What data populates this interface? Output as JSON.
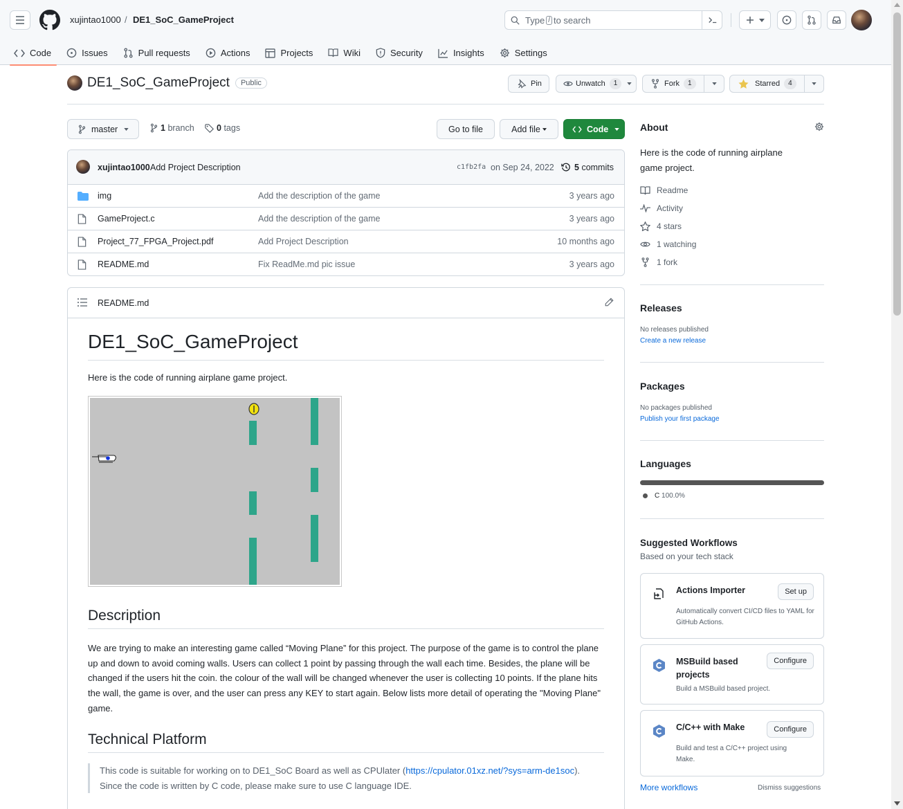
{
  "header": {
    "owner": "xujintao1000",
    "slash": "/",
    "repo": "DE1_SoC_GameProject",
    "search_pre": "Type",
    "search_key": "/",
    "search_post": "to search"
  },
  "tabs": [
    "Code",
    "Issues",
    "Pull requests",
    "Actions",
    "Projects",
    "Wiki",
    "Security",
    "Insights",
    "Settings"
  ],
  "repo": {
    "name": "DE1_SoC_GameProject",
    "visibility": "Public",
    "pin": "Pin",
    "unwatch": "Unwatch",
    "unwatch_count": "1",
    "fork": "Fork",
    "fork_count": "1",
    "starred": "Starred",
    "star_count": "4"
  },
  "branchbar": {
    "branch": "master",
    "branches_n": "1",
    "branches_label": "branch",
    "tags_n": "0",
    "tags_label": "tags",
    "goto": "Go to file",
    "addfile": "Add file",
    "code": "Code"
  },
  "commit": {
    "author": "xujintao1000",
    "message": "Add Project Description",
    "hash": "c1fb2fa",
    "date": "on Sep 24, 2022",
    "commits_n": "5",
    "commits_label": "commits"
  },
  "files": [
    {
      "name": "img",
      "message": "Add the description of the game",
      "age": "3 years ago",
      "type": "dir"
    },
    {
      "name": "GameProject.c",
      "message": "Add the description of the game",
      "age": "3 years ago",
      "type": "file"
    },
    {
      "name": "Project_77_FPGA_Project.pdf",
      "message": "Add Project Description",
      "age": "10 months ago",
      "type": "file"
    },
    {
      "name": "README.md",
      "message": "Fix ReadMe.md pic issue",
      "age": "3 years ago",
      "type": "file"
    }
  ],
  "readme": {
    "filename": "README.md",
    "title": "DE1_SoC_GameProject",
    "intro": "Here is the code of running airplane game project.",
    "h_description": "Description",
    "description": "We are trying to make an interesting game called “Moving Plane” for this project. The purpose of the game is to control the plane up and down to avoid coming walls. Users can collect 1 point by passing through the wall each time. Besides, the plane will be changed if the users hit the coin. the colour of the wall will be changed whenever the user is collecting 10 points. If the plane hits the wall, the game is over, and the user can press any KEY to start again. Below lists more detail of operating the \"Moving Plane\" game.",
    "h_platform": "Technical Platform",
    "platform_pre": "This code is suitable for working on to DE1_SoC Board as well as CPUlater (",
    "platform_link": "https://cpulator.01xz.net/?sys=arm-de1soc",
    "platform_post": "). Since the code is written by C code, please make sure to use C language IDE."
  },
  "about": {
    "title": "About",
    "text": "Here is the code of running airplane game project.",
    "readme": "Readme",
    "activity": "Activity",
    "stars": "4 stars",
    "watching": "1 watching",
    "fork": "1 fork"
  },
  "releases": {
    "title": "Releases",
    "none": "No releases published",
    "link": "Create a new release"
  },
  "packages": {
    "title": "Packages",
    "none": "No packages published",
    "link": "Publish your first package"
  },
  "languages": {
    "title": "Languages",
    "name": "C",
    "pct": "100.0%",
    "color": "#555555"
  },
  "workflows": {
    "title": "Suggested Workflows",
    "subtitle": "Based on your tech stack",
    "items": [
      {
        "name": "Actions Importer",
        "desc": "Automatically convert CI/CD files to YAML for GitHub Actions.",
        "button": "Set up"
      },
      {
        "name": "MSBuild based projects",
        "desc": "Build a MSBuild based project.",
        "button": "Configure"
      },
      {
        "name": "C/C++ with Make",
        "desc": "Build and test a C/C++ project using Make.",
        "button": "Configure"
      }
    ],
    "more": "More workflows",
    "dismiss": "Dismiss suggestions"
  },
  "colors": {
    "accent_tab": "#fd8c73",
    "code_button": "#1f883d",
    "link": "#0969da",
    "wall": "#2ea58a",
    "game_bg": "#c3c3c3"
  }
}
